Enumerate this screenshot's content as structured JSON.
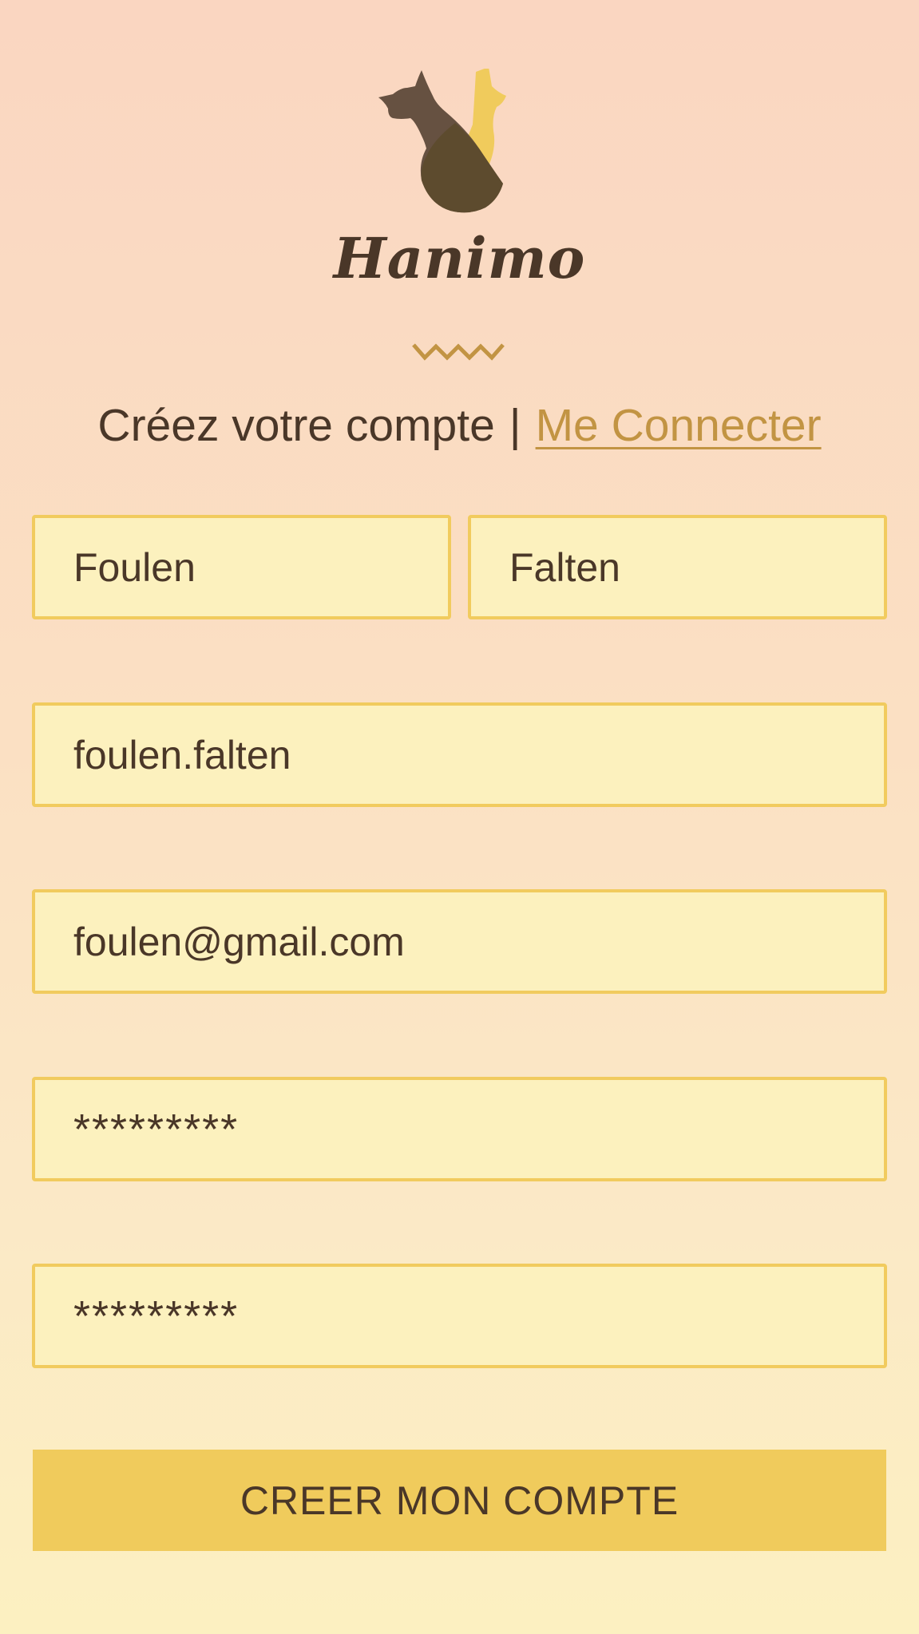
{
  "app": {
    "name": "Hanimo",
    "logo_icon": "dog-cat-silhouette-icon"
  },
  "header": {
    "zigzag_icon": "zigzag-divider-icon",
    "subtitle": "Créez votre compte",
    "separator": "|",
    "login_link": "Me Connecter"
  },
  "form": {
    "first_name": "Foulen",
    "last_name": "Falten",
    "username": "foulen.falten",
    "email": "foulen@gmail.com",
    "password": "*********",
    "password_confirm": "*********",
    "submit_label": "CREER MON COMPTE"
  },
  "colors": {
    "accent": "#f0cb5c",
    "link": "#c29443",
    "text": "#4a3728",
    "field_bg": "#fcf1be",
    "field_border": "#f1cb5e"
  }
}
